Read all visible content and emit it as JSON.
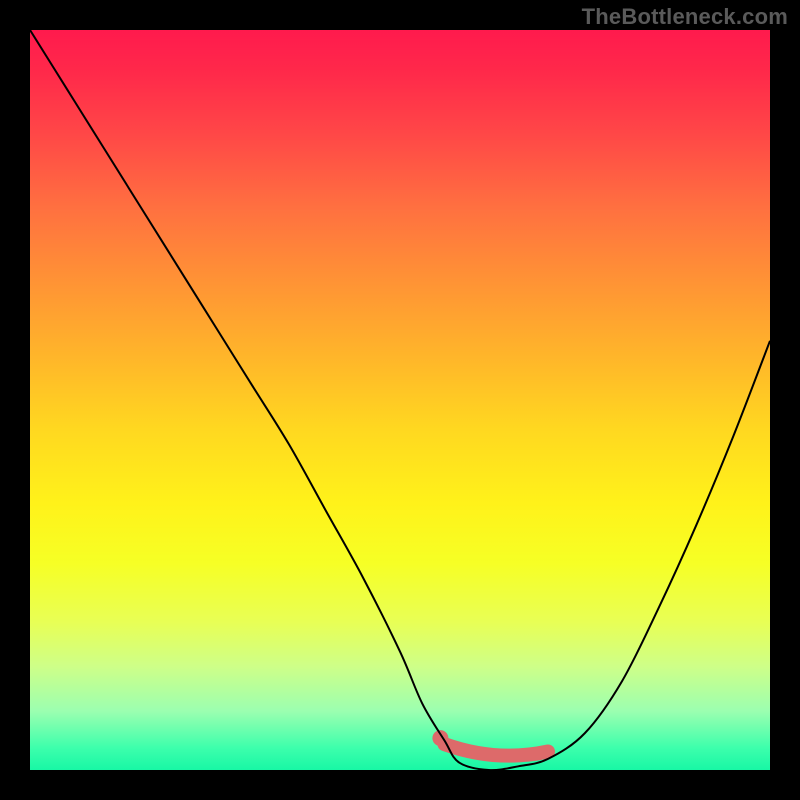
{
  "watermark": "TheBottleneck.com",
  "colors": {
    "background": "#000000",
    "curve": "#000000",
    "marker": "#dd6a6a",
    "gradient_top": "#ff1a4d",
    "gradient_bottom": "#18f7a5"
  },
  "chart_data": {
    "type": "line",
    "title": "",
    "xlabel": "",
    "ylabel": "",
    "xlim": [
      0,
      100
    ],
    "ylim": [
      0,
      100
    ],
    "grid": false,
    "description": "V-shaped bottleneck curve over vertical red-to-green gradient; minimum (optimal) region highlighted with salmon band near y≈0 around x≈58–70.",
    "series": [
      {
        "name": "bottleneck-curve",
        "x": [
          0,
          5,
          10,
          15,
          20,
          25,
          30,
          35,
          40,
          45,
          50,
          53,
          56,
          58,
          62,
          66,
          70,
          75,
          80,
          85,
          90,
          95,
          100
        ],
        "y": [
          100,
          92,
          84,
          76,
          68,
          60,
          52,
          44,
          35,
          26,
          16,
          9,
          4,
          1,
          0,
          0.5,
          1.5,
          5,
          12,
          22,
          33,
          45,
          58
        ]
      }
    ],
    "optimal_band": {
      "x_start": 56,
      "x_end": 70,
      "y": 1
    }
  }
}
